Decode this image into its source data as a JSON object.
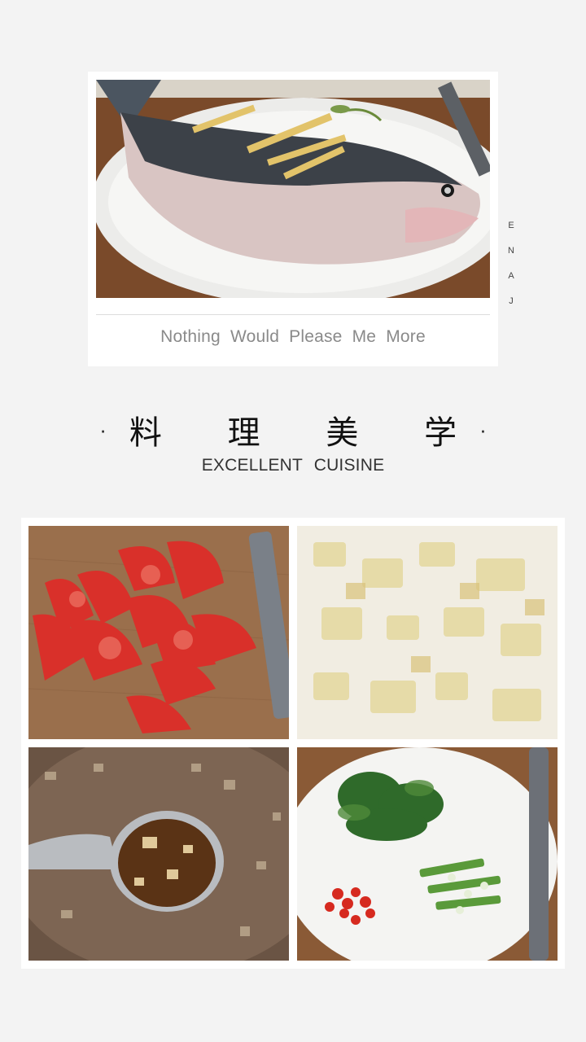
{
  "hero": {
    "caption": "Nothing Would Please Me More"
  },
  "side_label": [
    "J",
    "A",
    "N",
    "E"
  ],
  "title": {
    "chinese": "料 理 美 学",
    "english": "EXCELLENT CUISINE",
    "bullet": "·"
  },
  "photos": [
    {
      "name": "steamed-fish-photo"
    },
    {
      "name": "tomato-wedges-photo"
    },
    {
      "name": "minced-ginger-photo"
    },
    {
      "name": "sauce-spoon-photo"
    },
    {
      "name": "chopped-herbs-plate-photo"
    }
  ]
}
